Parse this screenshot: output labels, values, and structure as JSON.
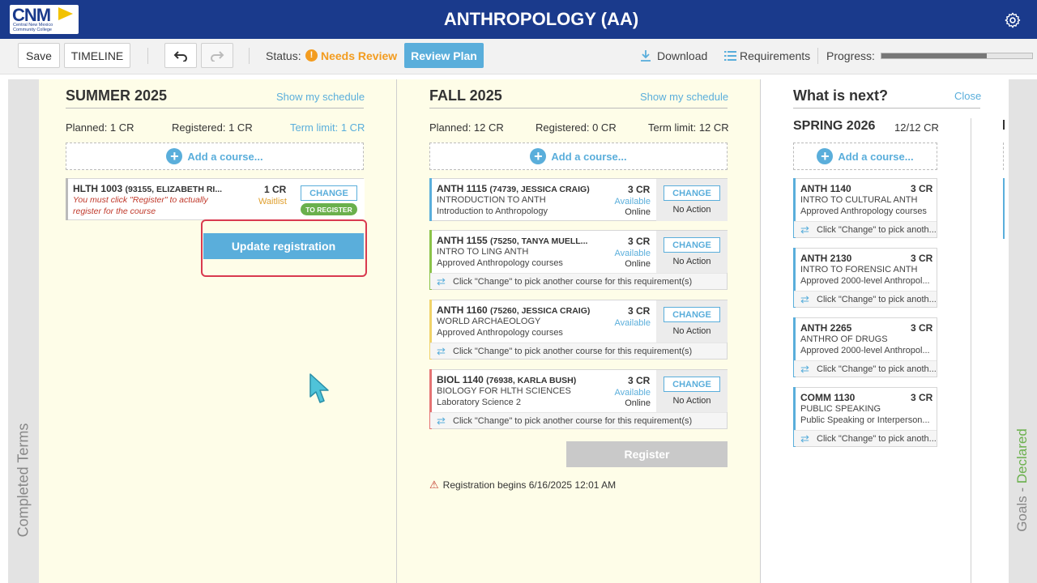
{
  "header": {
    "logo_text": "CNM",
    "logo_subtext": "Central New Mexico Community College",
    "title": "ANTHROPOLOGY (AA)"
  },
  "toolbar": {
    "save_label": "Save",
    "timeline_label": "TIMELINE",
    "status_label": "Status:",
    "status_icon": "!",
    "status_value": "Needs Review",
    "review_plan_label": "Review Plan",
    "download_label": "Download",
    "requirements_label": "Requirements",
    "progress_label": "Progress:",
    "progress_fraction": 0.7
  },
  "side": {
    "left_label": "Completed Terms",
    "right_label_prefix": "Goals - ",
    "right_label_status": "Declared"
  },
  "summer": {
    "title": "SUMMER 2025",
    "show_schedule": "Show my schedule",
    "planned": "Planned: 1 CR",
    "registered": "Registered: 1 CR",
    "term_limit": "Term limit: 1 CR",
    "add_course": "Add a course...",
    "course": {
      "code": "HLTH 1003",
      "section": "(93155, ELIZABETH RI...",
      "credits": "1 CR",
      "warning_line1": "You must click \"Register\" to actually",
      "warning_line2": "register for the course",
      "availability": "Waitlist",
      "change_label": "CHANGE",
      "badge": "TO REGISTER"
    },
    "update_registration": "Update registration"
  },
  "fall": {
    "title": "FALL 2025",
    "show_schedule": "Show my schedule",
    "planned": "Planned: 12 CR",
    "registered": "Registered: 0 CR",
    "term_limit": "Term limit: 12 CR",
    "add_course": "Add a course...",
    "courses": [
      {
        "code": "ANTH 1115",
        "section": "(74739, JESSICA CRAIG)",
        "credits": "3 CR",
        "title": "INTRODUCTION TO ANTH",
        "requirement": "Introduction to Anthropology",
        "availability": "Available",
        "mode": "Online",
        "change_label": "CHANGE",
        "action": "No Action"
      },
      {
        "code": "ANTH 1155",
        "section": "(75250, TANYA MUELL...",
        "credits": "3 CR",
        "title": "INTRO TO LING ANTH",
        "requirement": "Approved Anthropology courses",
        "availability": "Available",
        "mode": "Online",
        "change_label": "CHANGE",
        "action": "No Action",
        "note": "Click \"Change\" to pick another course for this requirement(s)"
      },
      {
        "code": "ANTH 1160",
        "section": "(75260, JESSICA CRAIG)",
        "credits": "3 CR",
        "title": "WORLD ARCHAEOLOGY",
        "requirement": "Approved Anthropology courses",
        "availability": "Available",
        "mode": "",
        "change_label": "CHANGE",
        "action": "No Action",
        "note": "Click \"Change\" to pick another course for this requirement(s)"
      },
      {
        "code": "BIOL 1140",
        "section": "(76938, KARLA BUSH)",
        "credits": "3 CR",
        "title": "BIOLOGY FOR HLTH SCIENCES",
        "requirement": "Laboratory Science 2",
        "availability": "Available",
        "mode": "Online",
        "change_label": "CHANGE",
        "action": "No Action",
        "note": "Click \"Change\" to pick another course for this requirement(s)"
      }
    ],
    "register_label": "Register",
    "registration_note": "Registration begins 6/16/2025 12:01 AM"
  },
  "next": {
    "title": "What is next?",
    "close": "Close",
    "term_title": "SPRING 2026",
    "term_credits": "12/12 CR",
    "add_course": "Add a course...",
    "courses": [
      {
        "code": "ANTH 1140",
        "credits": "3 CR",
        "title": "INTRO TO CULTURAL ANTH",
        "requirement": "Approved Anthropology courses",
        "note": "Click \"Change\" to pick anoth..."
      },
      {
        "code": "ANTH 2130",
        "credits": "3 CR",
        "title": "INTRO TO FORENSIC ANTH",
        "requirement": "Approved 2000-level Anthropol...",
        "note": "Click \"Change\" to pick anoth..."
      },
      {
        "code": "ANTH 2265",
        "credits": "3 CR",
        "title": "ANTHRO OF DRUGS",
        "requirement": "Approved 2000-level Anthropol...",
        "note": "Click \"Change\" to pick anoth..."
      },
      {
        "code": "COMM 1130",
        "credits": "3 CR",
        "title": "PUBLIC SPEAKING",
        "requirement": "Public Speaking or Interperson...",
        "note": "Click \"Change\" to pick anoth..."
      }
    ]
  },
  "colors": {
    "header_bg": "#1a3a8c",
    "accent_blue": "#5aaedb",
    "status_orange": "#f39c1f",
    "term_bg": "#fefde8",
    "highlight_red": "#d93a4f"
  }
}
